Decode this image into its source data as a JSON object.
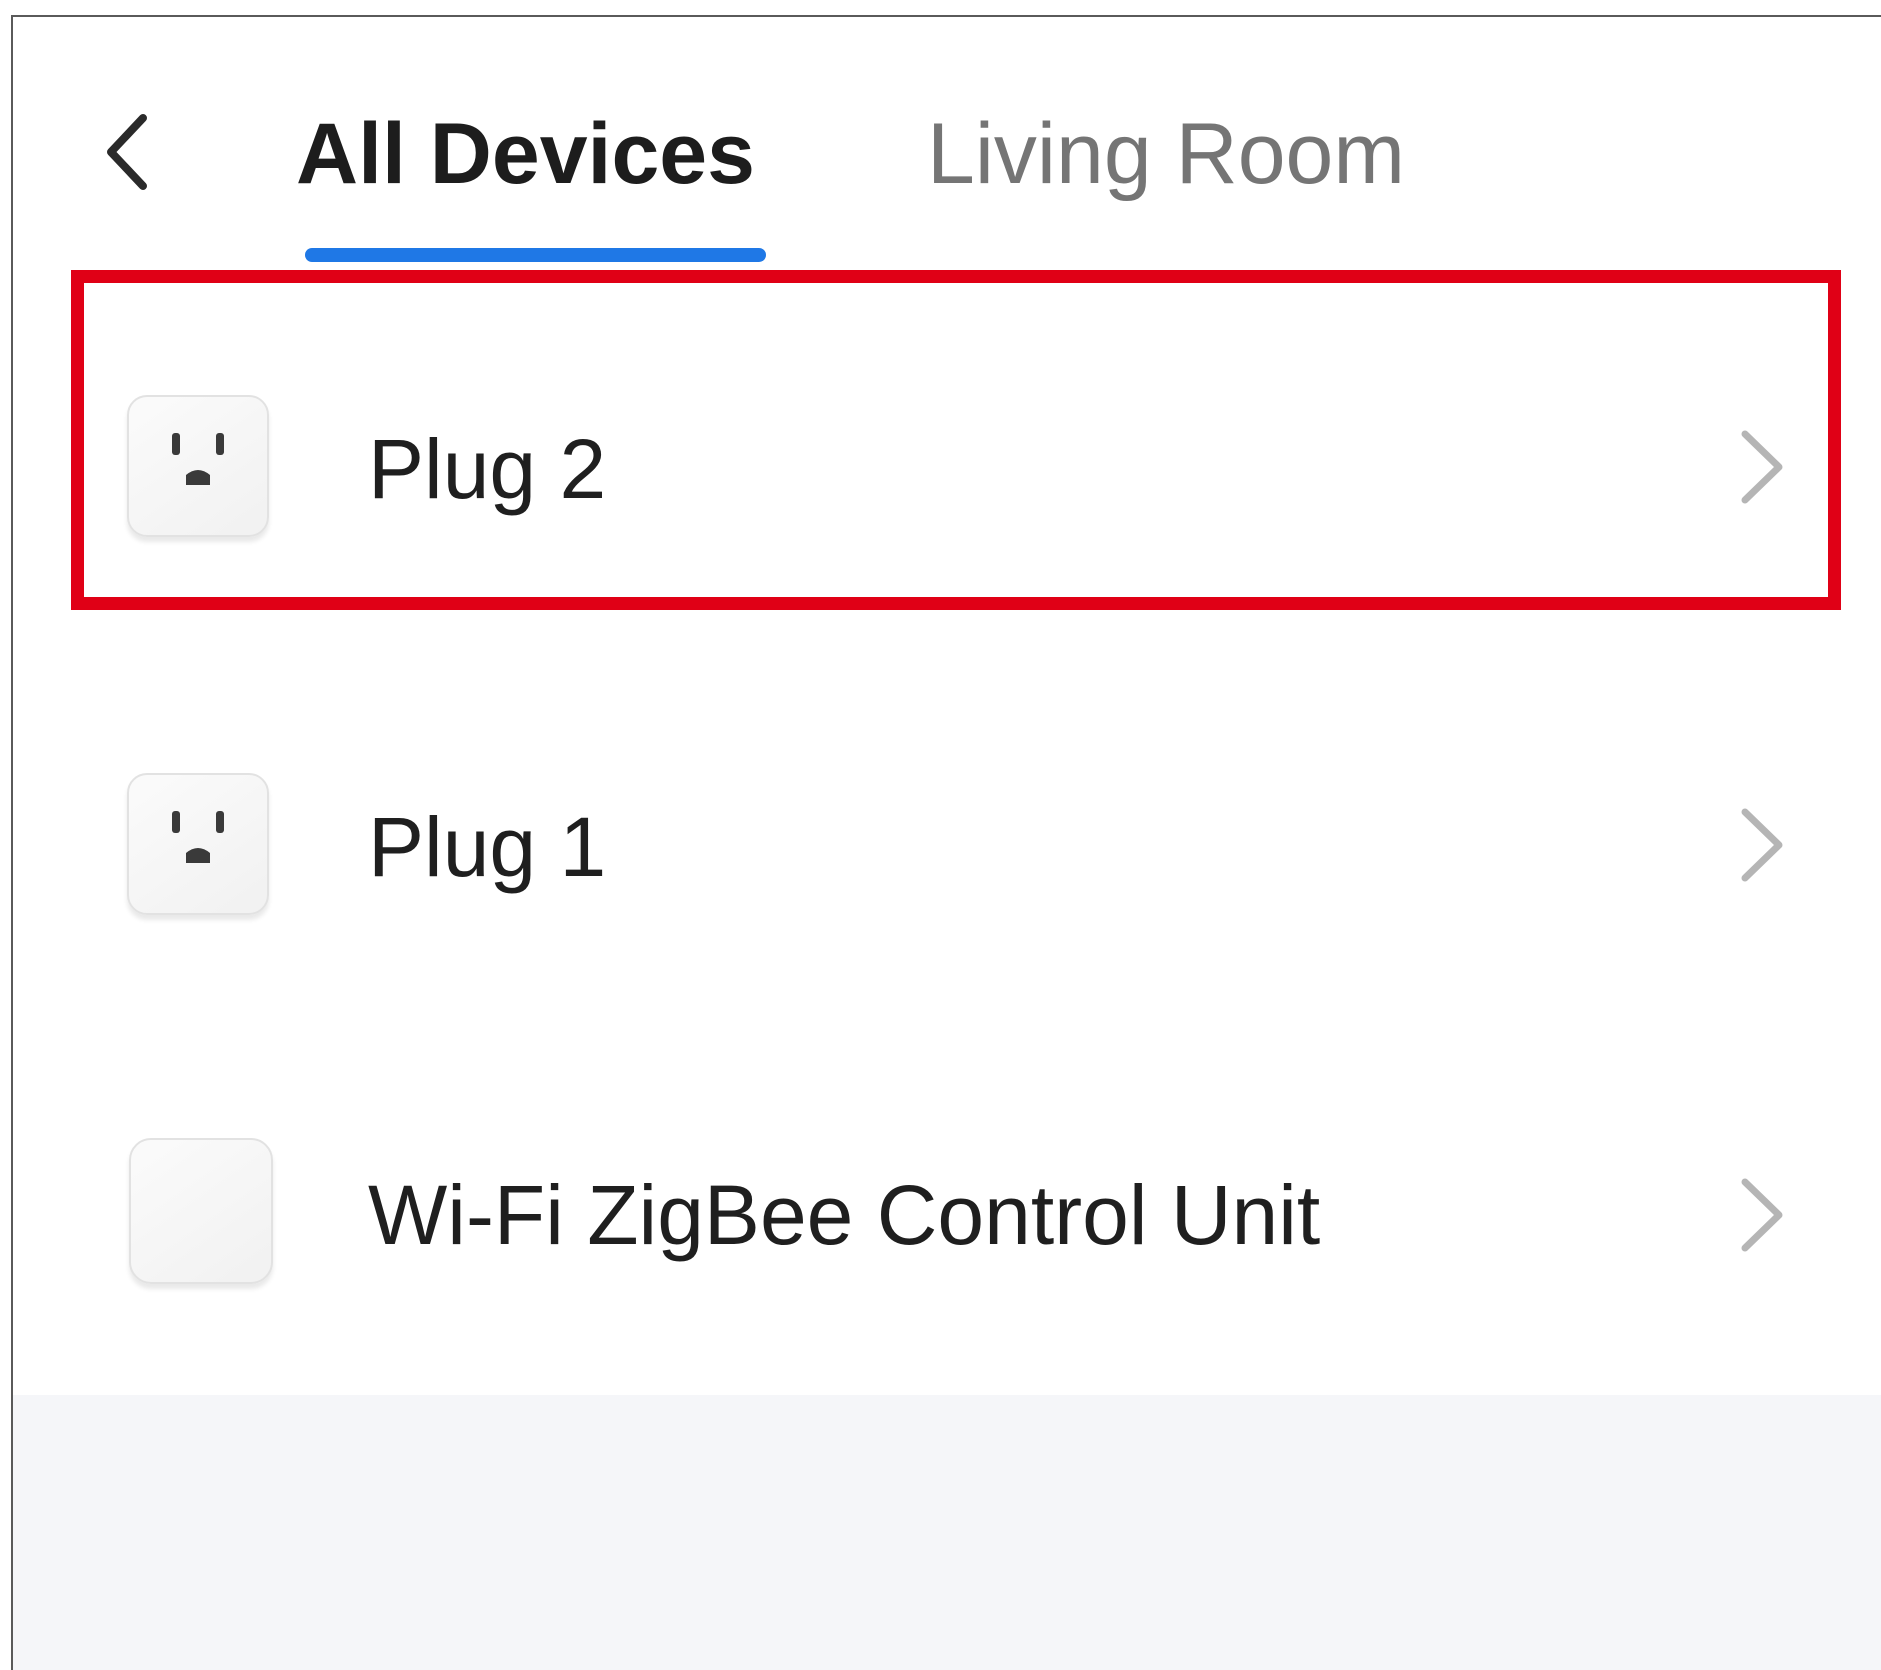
{
  "header": {
    "back_icon": "chevron-left-icon",
    "tabs": [
      {
        "label": "All Devices",
        "active": true
      },
      {
        "label": "Living Room",
        "active": false
      }
    ],
    "active_indicator_color": "#1f78e6"
  },
  "devices": [
    {
      "name": "Plug 2",
      "icon": "smart-plug-icon",
      "highlighted": true
    },
    {
      "name": "Plug 1",
      "icon": "smart-plug-icon",
      "highlighted": false
    },
    {
      "name": "Wi-Fi ZigBee Control Unit",
      "icon": "hub-icon",
      "highlighted": false
    }
  ],
  "colors": {
    "highlight": "#e00016",
    "accent": "#1f78e6",
    "text_primary": "#1f1f1f",
    "text_secondary": "#757575",
    "chevron": "#b5b5b5",
    "footer_background": "#f5f6f9"
  }
}
